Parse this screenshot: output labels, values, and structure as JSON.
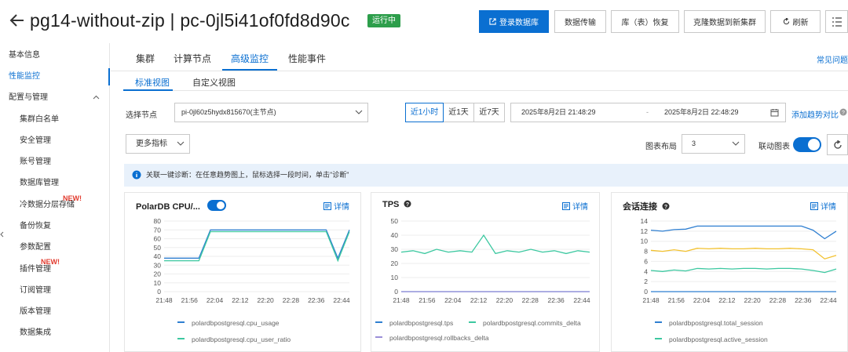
{
  "header": {
    "title": "pg14-without-zip | pc-0jl5i41of0fd8d90c",
    "status": "运行中",
    "buttons": {
      "login": "登录数据库",
      "transfer": "数据传输",
      "restore": "库（表）恢复",
      "clone": "克隆数据到新集群",
      "refresh": "刷新"
    }
  },
  "sidebar": {
    "items": [
      {
        "label": "基本信息"
      },
      {
        "label": "性能监控"
      },
      {
        "label": "配置与管理"
      },
      {
        "label": "集群白名单"
      },
      {
        "label": "安全管理"
      },
      {
        "label": "账号管理"
      },
      {
        "label": "数据库管理"
      },
      {
        "label": "冷数据分层存储"
      },
      {
        "label": "备份恢复"
      },
      {
        "label": "参数配置"
      },
      {
        "label": "插件管理"
      },
      {
        "label": "订阅管理"
      },
      {
        "label": "版本管理"
      },
      {
        "label": "数据集成"
      }
    ],
    "new_badge": "NEW!"
  },
  "tabs": [
    "集群",
    "计算节点",
    "高级监控",
    "性能事件"
  ],
  "faq": "常见问题",
  "subtabs": [
    "标准视图",
    "自定义视图"
  ],
  "filters": {
    "node_label": "选择节点",
    "node_value": "pi-0jl60z5hydx815670(主节点)",
    "ranges": [
      "近1小时",
      "近1天",
      "近7天"
    ],
    "start_time": "2025年8月2日 21:48:29",
    "range_sep": "-",
    "end_time": "2025年8月2日 22:48:29",
    "add_compare": "添加趋势对比",
    "more_metrics": "更多指标",
    "layout_label": "图表布局",
    "layout_value": "3",
    "linked_label": "联动图表"
  },
  "info": "关联一键诊断：在任意趋势图上，鼠标选择一段时间，单击\"诊断\"",
  "detail_label": "详情",
  "charts_meta": {
    "colors": {
      "blue": "#2f7fd1",
      "green": "#3cc8a0",
      "yellow": "#f2c12e",
      "purple": "#9b8fd8",
      "orange": "#f0a050"
    }
  },
  "chart_data": [
    {
      "type": "line",
      "title": "PolarDB CPU/...",
      "x": [
        "21:48",
        "21:56",
        "22:04",
        "22:12",
        "22:20",
        "22:28",
        "22:36",
        "22:44"
      ],
      "ylim": [
        0,
        80
      ],
      "yticks": [
        0,
        10,
        20,
        30,
        40,
        50,
        60,
        70,
        80
      ],
      "series": [
        {
          "name": "polardbpostgresql.cpu_usage",
          "color": "#2f7fd1",
          "values": [
            38,
            38,
            38,
            38,
            70,
            70,
            70,
            70,
            70,
            70,
            70,
            70,
            70,
            70,
            70,
            38,
            70
          ]
        },
        {
          "name": "polardbpostgresql.cpu_user_ratio",
          "color": "#3cc8a0",
          "values": [
            35,
            35,
            35,
            35,
            68,
            68,
            68,
            68,
            68,
            68,
            68,
            68,
            68,
            68,
            68,
            35,
            68
          ]
        }
      ]
    },
    {
      "type": "line",
      "title": "TPS",
      "x": [
        "21:48",
        "21:56",
        "22:04",
        "22:12",
        "22:20",
        "22:28",
        "22:36",
        "22:44"
      ],
      "ylim": [
        0,
        50
      ],
      "yticks": [
        0,
        10,
        20,
        30,
        40,
        50
      ],
      "series": [
        {
          "name": "polardbpostgresql.tps",
          "color": "#2f7fd1",
          "values": [
            0,
            0,
            0,
            0,
            0,
            0,
            0,
            0,
            0,
            0,
            0,
            0,
            0,
            0,
            0,
            0,
            0
          ]
        },
        {
          "name": "polardbpostgresql.commits_delta",
          "color": "#3cc8a0",
          "values": [
            28,
            29,
            27,
            30,
            28,
            29,
            28,
            40,
            27,
            29,
            28,
            30,
            28,
            29,
            27,
            29,
            28
          ]
        },
        {
          "name": "polardbpostgresql.rollbacks_delta",
          "color": "#9b8fd8",
          "values": [
            0,
            0,
            0,
            0,
            0,
            0,
            0,
            0,
            0,
            0,
            0,
            0,
            0,
            0,
            0,
            0,
            0
          ]
        }
      ]
    },
    {
      "type": "line",
      "title": "会话连接",
      "x": [
        "21:48",
        "21:56",
        "22:04",
        "22:12",
        "22:20",
        "22:28",
        "22:36",
        "22:44"
      ],
      "ylim": [
        0,
        14
      ],
      "yticks": [
        0,
        2,
        4,
        6,
        8,
        10,
        12,
        14
      ],
      "series": [
        {
          "name": "polardbpostgresql.total_session",
          "color": "#2f7fd1",
          "values": [
            12.2,
            12,
            12.3,
            12.4,
            13,
            13,
            13,
            13,
            13,
            13,
            13,
            13,
            13,
            13,
            12.2,
            10.5,
            12
          ]
        },
        {
          "name": "",
          "color": "#f2c12e",
          "values": [
            8.2,
            8,
            8.3,
            8,
            8.6,
            8.5,
            8.6,
            8.5,
            8.5,
            8.6,
            8.5,
            8.5,
            8.6,
            8.5,
            8.3,
            6.5,
            7.2
          ]
        },
        {
          "name": "polardbpostgresql.active_session",
          "color": "#3cc8a0",
          "values": [
            4.2,
            4,
            4.3,
            4.1,
            4.6,
            4.5,
            4.6,
            4.5,
            4.6,
            4.6,
            4.5,
            4.6,
            4.6,
            4.5,
            4.2,
            3.8,
            4.5
          ]
        },
        {
          "name": "",
          "color": "#2f7fd1",
          "values": [
            0,
            0,
            0,
            0,
            0,
            0,
            0,
            0,
            0,
            0,
            0,
            0,
            0,
            0,
            0,
            0,
            0
          ]
        }
      ]
    }
  ]
}
